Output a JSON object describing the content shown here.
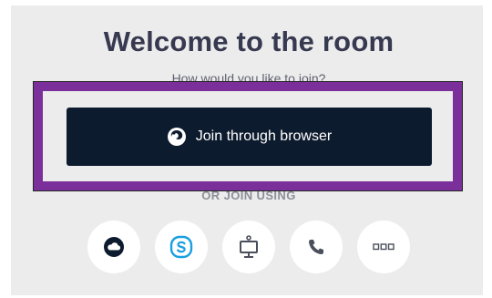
{
  "header": {
    "title": "Welcome to the room",
    "subtitle": "How would you like to join?"
  },
  "primary": {
    "join_label": "Join through browser",
    "icon": "firefox-icon"
  },
  "alternatives": {
    "label": "OR JOIN USING",
    "options": [
      {
        "icon": "cloud-app-icon",
        "color": "#0d1b2e"
      },
      {
        "icon": "skype-icon",
        "color": "#1a9fe0"
      },
      {
        "icon": "room-system-icon",
        "color": "#4a4f5c"
      },
      {
        "icon": "phone-icon",
        "color": "#4a4f5c"
      },
      {
        "icon": "more-options-icon",
        "color": "#4a4f5c"
      }
    ]
  },
  "colors": {
    "background": "#ececec",
    "button": "#0d1b2e",
    "highlight": "#7b2f9a"
  }
}
